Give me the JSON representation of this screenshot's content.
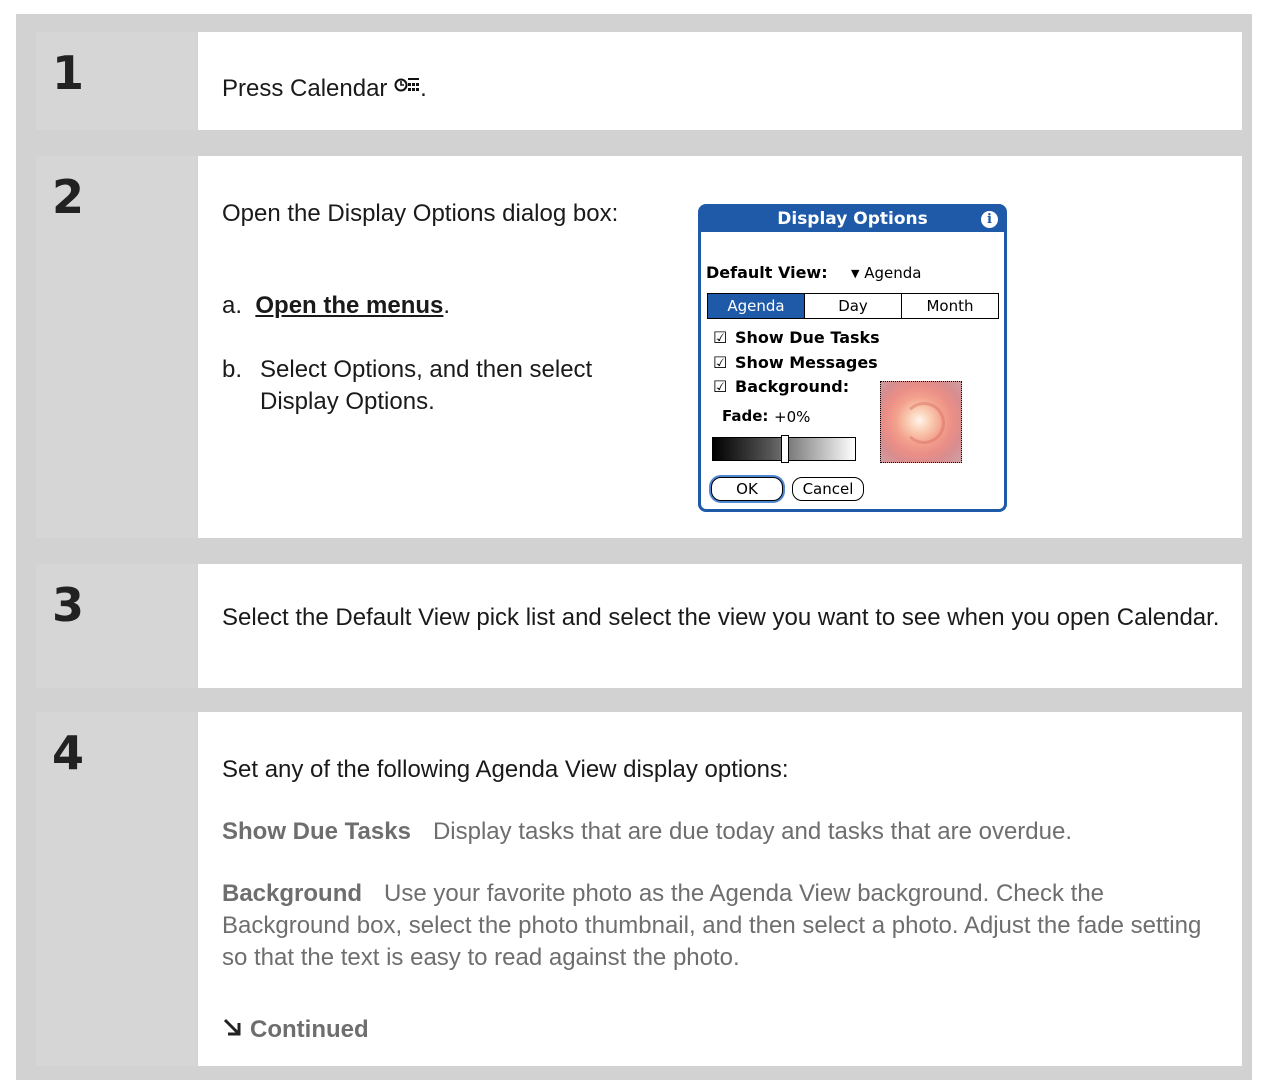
{
  "steps": [
    {
      "number": "1",
      "text_before": "Press Calendar ",
      "icon_glyph": "⏱",
      "text_after": "."
    },
    {
      "number": "2",
      "intro": "Open the Display Options dialog box:",
      "a_prefix": "a.",
      "a_link": "Open the menus",
      "a_after": ".",
      "b_prefix": "b.",
      "b_text": "Select Options, and then select Display Options."
    },
    {
      "number": "3",
      "text": "Select the Default View pick list and select the view you want to see when you open Calendar."
    },
    {
      "number": "4",
      "intro": "Set any of the following Agenda View display options:",
      "opt1_term": "Show Due Tasks",
      "opt1_desc": "Display tasks that are due today and tasks that are overdue.",
      "opt2_term": "Background",
      "opt2_desc": "Use your favorite photo as the Agenda View background. Check the Background box, select the photo thumbnail, and then select a photo. Adjust the fade setting so that the text is easy to read against the photo.",
      "continued": "Continued"
    }
  ],
  "dialog": {
    "title": "Display Options",
    "default_view_label": "Default View:",
    "default_view_value": "Agenda",
    "tabs": [
      "Agenda",
      "Day",
      "Month"
    ],
    "selected_tab": "Agenda",
    "check1": "Show Due Tasks",
    "check2": "Show Messages",
    "check3": "Background:",
    "fade_label": "Fade:",
    "fade_value": "+0%",
    "fade_level": 0.5,
    "ok": "OK",
    "cancel": "Cancel",
    "accent_color": "#1e5aa8"
  }
}
